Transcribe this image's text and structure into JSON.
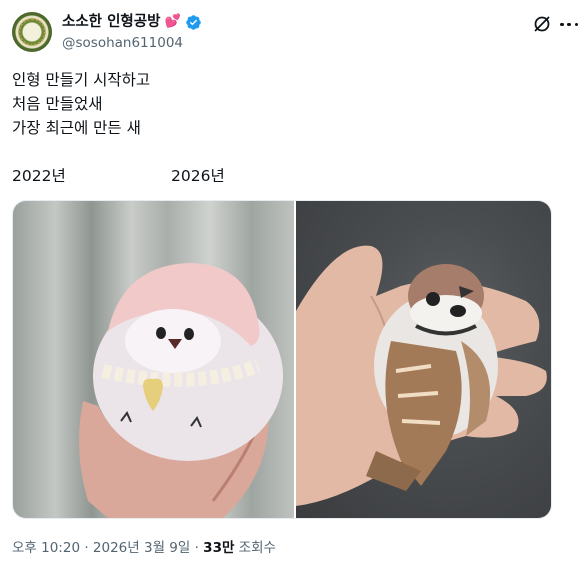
{
  "author": {
    "display_name": "소소한 인형공방",
    "name_emoji": "💕",
    "handle": "@sosohan611004"
  },
  "tweet": {
    "lines": [
      "인형 만들기 시작하고",
      "처음 만들었새",
      "가장 최근에 만든 새"
    ],
    "year_left": "2022년",
    "year_right": "2026년"
  },
  "media": {
    "left_photo": "felt-bird-doll-photo",
    "right_photo": "sparrow-doll-photo"
  },
  "meta": {
    "timestamp": "오후 10:20 · 2026년 3월 9일 · ",
    "views_count": "33만",
    "views_label": " 조회수"
  },
  "icons": {
    "top_right": "grok-slash-icon",
    "more": "more-icon",
    "verified": "verified-badge-icon"
  },
  "colors": {
    "verified": "#1d9bf0",
    "secondary_text": "#536471"
  }
}
